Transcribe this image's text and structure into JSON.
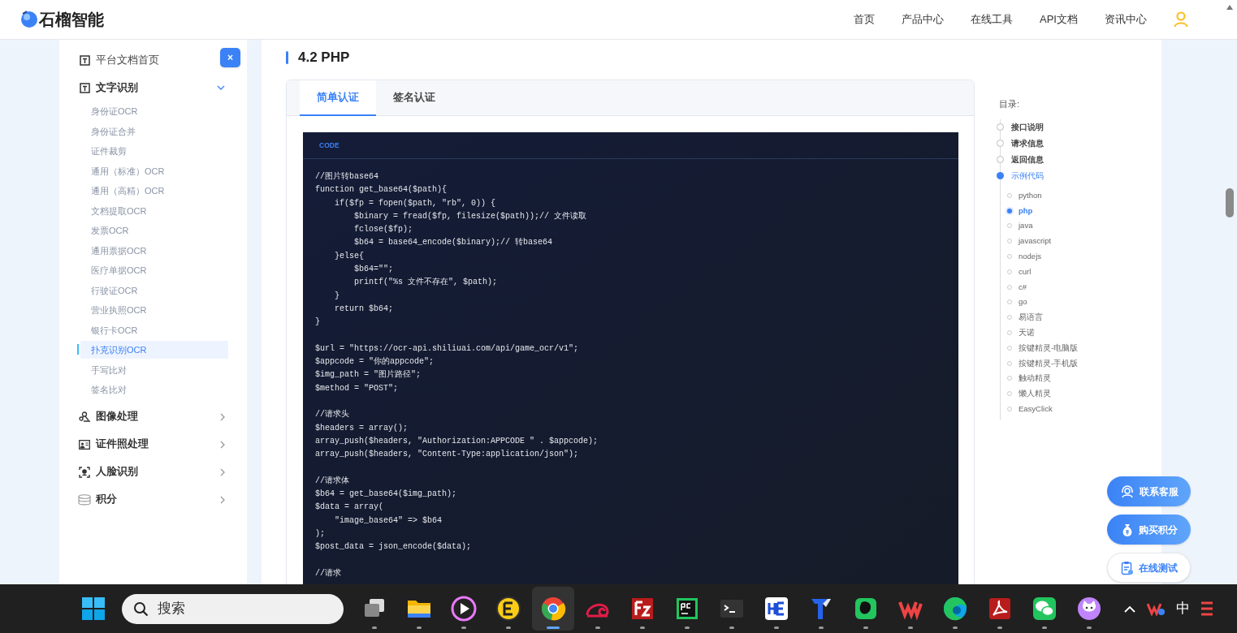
{
  "header": {
    "brand": "石榴智能",
    "nav": [
      "首页",
      "产品中心",
      "在线工具",
      "API文档",
      "资讯中心"
    ]
  },
  "sidebar": {
    "close_label": "×",
    "items": [
      {
        "kind": "doc",
        "label": "平台文档首页"
      },
      {
        "kind": "text",
        "label": "文字识别",
        "expanded": true,
        "children": [
          {
            "label": "身份证OCR",
            "selected": false
          },
          {
            "label": "身份证合并",
            "selected": false
          },
          {
            "label": "证件裁剪",
            "selected": false
          },
          {
            "label": "通用（标准）OCR",
            "selected": false
          },
          {
            "label": "通用（高精）OCR",
            "selected": false
          },
          {
            "label": "文档提取OCR",
            "selected": false
          },
          {
            "label": "发票OCR",
            "selected": false
          },
          {
            "label": "通用票据OCR",
            "selected": false
          },
          {
            "label": "医疗单据OCR",
            "selected": false
          },
          {
            "label": "行驶证OCR",
            "selected": false
          },
          {
            "label": "营业执照OCR",
            "selected": false
          },
          {
            "label": "银行卡OCR",
            "selected": false
          },
          {
            "label": "扑克识别OCR",
            "selected": true
          },
          {
            "label": "手写比对",
            "selected": false
          },
          {
            "label": "签名比对",
            "selected": false
          }
        ]
      },
      {
        "kind": "image",
        "label": "图像处理",
        "expanded": false
      },
      {
        "kind": "idphoto",
        "label": "证件照处理",
        "expanded": false
      },
      {
        "kind": "face",
        "label": "人脸识别",
        "expanded": false
      },
      {
        "kind": "points",
        "label": "积分",
        "expanded": false
      }
    ]
  },
  "content": {
    "title": "4.2 PHP",
    "tabs": [
      {
        "label": "简单认证",
        "selected": true
      },
      {
        "label": "签名认证",
        "selected": false
      }
    ],
    "code": {
      "label": "CODE",
      "blocks": [
        [
          "//图片转base64",
          "function get_base64($path){",
          "    if($fp = fopen($path, \"rb\", 0)) {",
          "        $binary = fread($fp, filesize($path));// 文件读取",
          "        fclose($fp);",
          "        $b64 = base64_encode($binary);// 转base64",
          "    }else{",
          "        $b64=\"\";",
          "        printf(\"%s 文件不存在\", $path);",
          "    }",
          "    return $b64;",
          "}"
        ],
        [
          "$url = \"https://ocr-api.shiliuai.com/api/game_ocr/v1\";",
          "$appcode = \"你的appcode\";",
          "$img_path = \"图片路径\";",
          "$method = \"POST\";"
        ],
        [
          "//请求头",
          "$headers = array();",
          "array_push($headers, \"Authorization:APPCODE \" . $appcode);",
          "array_push($headers, \"Content-Type:application/json\");"
        ],
        [
          "//请求体",
          "$b64 = get_base64($img_path);",
          "$data = array(",
          "    \"image_base64\" => $b64",
          ");",
          "$post_data = json_encode($data);"
        ],
        [
          "//请求"
        ]
      ]
    }
  },
  "toc": {
    "title": "目录:",
    "items": [
      {
        "label": "接口说明",
        "selected": false
      },
      {
        "label": "请求信息",
        "selected": false
      },
      {
        "label": "返回信息",
        "selected": false
      },
      {
        "label": "示例代码",
        "selected": true,
        "children": [
          {
            "label": "python",
            "selected": false
          },
          {
            "label": "php",
            "selected": true
          },
          {
            "label": "java",
            "selected": false
          },
          {
            "label": "javascript",
            "selected": false
          },
          {
            "label": "nodejs",
            "selected": false
          },
          {
            "label": "curl",
            "selected": false
          },
          {
            "label": "c#",
            "selected": false
          },
          {
            "label": "go",
            "selected": false
          },
          {
            "label": "易语言",
            "selected": false
          },
          {
            "label": "天诺",
            "selected": false
          },
          {
            "label": "按键精灵-电脑版",
            "selected": false
          },
          {
            "label": "按键精灵-手机版",
            "selected": false
          },
          {
            "label": "触动精灵",
            "selected": false
          },
          {
            "label": "懒人精灵",
            "selected": false
          },
          {
            "label": "EasyClick",
            "selected": false
          }
        ]
      }
    ]
  },
  "float_buttons": [
    {
      "kind": "service",
      "label": "联系客服"
    },
    {
      "kind": "buy",
      "label": "购买积分"
    },
    {
      "kind": "test",
      "label": "在线测试"
    }
  ],
  "taskbar": {
    "search_placeholder": "搜索",
    "apps": [
      {
        "kind": "taskview",
        "selected": false
      },
      {
        "kind": "folder",
        "selected": false
      },
      {
        "kind": "player",
        "selected": false
      },
      {
        "kind": "e",
        "selected": false
      },
      {
        "kind": "chrome",
        "selected": true
      },
      {
        "kind": "snail",
        "selected": false
      },
      {
        "kind": "filezilla",
        "selected": false
      },
      {
        "kind": "pycharm",
        "selected": false
      },
      {
        "kind": "terminal",
        "selected": false
      },
      {
        "kind": "he",
        "selected": false
      },
      {
        "kind": "arrow",
        "selected": false
      },
      {
        "kind": "evernote",
        "selected": false
      },
      {
        "kind": "wps",
        "selected": false
      },
      {
        "kind": "edge",
        "selected": false
      },
      {
        "kind": "pdf",
        "selected": false
      },
      {
        "kind": "wechat",
        "selected": false
      },
      {
        "kind": "cat",
        "selected": false
      }
    ],
    "ime": "中"
  }
}
